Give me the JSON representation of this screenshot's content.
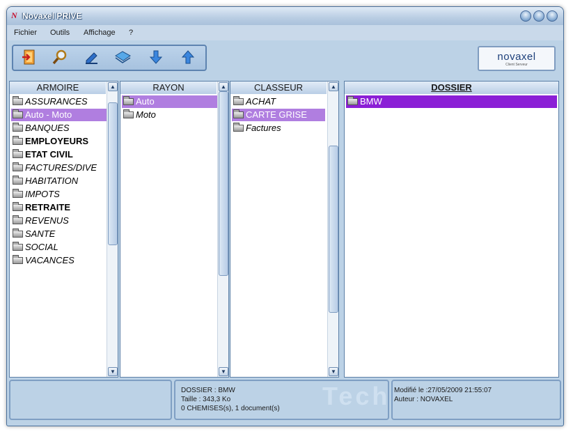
{
  "window": {
    "title": "Novaxel PRIVE"
  },
  "menu": [
    "Fichier",
    "Outils",
    "Affichage",
    "?"
  ],
  "toolbar": {
    "icons": [
      "exit-icon",
      "search-icon",
      "edit-icon",
      "scan-icon",
      "arrow-down-icon",
      "arrow-up-icon"
    ]
  },
  "brand": {
    "logo": "novaxel",
    "tagline": "Client Serveur"
  },
  "panes": {
    "armoire": {
      "header": "ARMOIRE",
      "items": [
        "ASSURANCES",
        "Auto - Moto",
        "BANQUES",
        "EMPLOYEURS",
        "ETAT CIVIL",
        "FACTURES/DIVE",
        "HABITATION",
        "IMPOTS",
        "RETRAITE",
        "REVENUS",
        "SANTE",
        "SOCIAL",
        "VACANCES"
      ]
    },
    "rayon": {
      "header": "RAYON",
      "items": [
        "Auto",
        "Moto"
      ]
    },
    "classeur": {
      "header": "CLASSEUR",
      "items": [
        "ACHAT",
        "CARTE GRISE",
        "Factures"
      ]
    },
    "dossier": {
      "header": "DOSSIER",
      "items": [
        "BMW"
      ]
    }
  },
  "status": {
    "dossier": "DOSSIER : BMW",
    "taille": "Taille : 343,3 Ko",
    "contenu": "0 CHEMISES(s), 1 document(s)",
    "modifie": "Modifié le :27/05/2009 21:55:07",
    "auteur": "Auteur : NOVAXEL",
    "watermark": "Tech"
  }
}
